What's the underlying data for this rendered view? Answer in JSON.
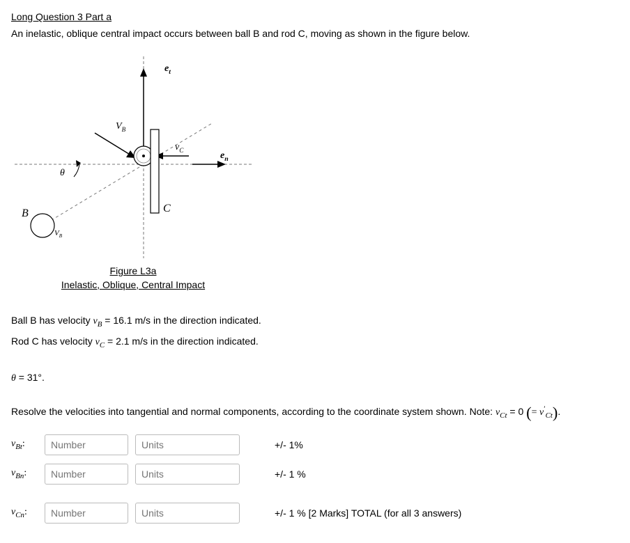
{
  "title": "Long Question 3 Part a",
  "intro": "An inelastic, oblique central impact occurs between ball B and rod C, moving as shown in the figure below.",
  "figure": {
    "caption_line1": "Figure L3a",
    "caption_line2": "Inelastic, Oblique, Central Impact",
    "labels": {
      "et": "e",
      "et_sub": "t",
      "en": "e",
      "en_sub": "n",
      "VB": "V",
      "VB_sub": "B",
      "vc": "v",
      "vc_sub": "C",
      "theta": "θ",
      "B": "B",
      "C": "C",
      "VB2": "V",
      "VB2_sub": "B"
    }
  },
  "givens": {
    "line1_pre": "Ball B has velocity ",
    "line1_varsub": "B",
    "line1_mid": " = ",
    "line1_val": "16.1 m/s in the direction indicated.",
    "line2_pre": "Rod C has velocity ",
    "line2_varsub": "C",
    "line2_mid": " = ",
    "line2_val": "2.1 m/s in the direction indicated."
  },
  "theta": {
    "var": "θ",
    "eq": " = ",
    "val": "31°."
  },
  "resolve": {
    "pre": "Resolve the velocities into tangential and normal components, according to the coordinate system shown. Note: ",
    "eq": " = 0 ",
    "primesub": "Ct",
    "dot": "."
  },
  "rows": {
    "vbt_sub": "Bt",
    "vbn_sub": "Bn",
    "vcn_sub": "Cn",
    "colon": ":"
  },
  "placeholders": {
    "number": "Number",
    "units": "Units"
  },
  "tolerances": {
    "t1": "+/- 1%",
    "t2": "+/- 1 %",
    "t3": "+/- 1 % [2 Marks] TOTAL (for all 3 answers)"
  }
}
